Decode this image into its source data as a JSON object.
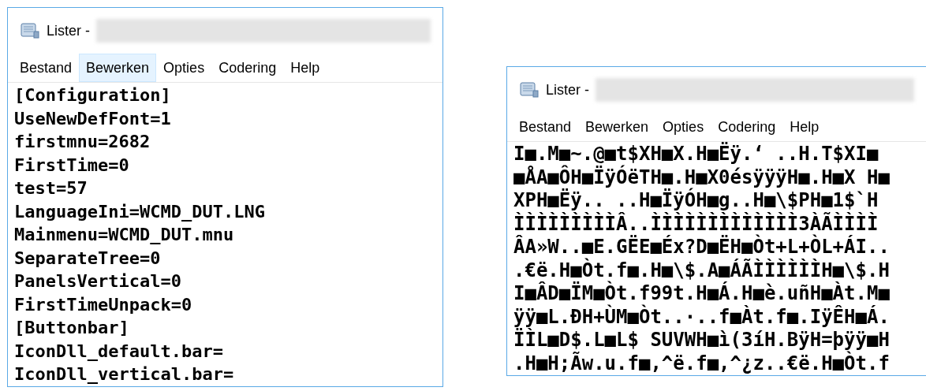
{
  "windows": [
    {
      "title": "Lister -",
      "menu": [
        {
          "label": "Bestand",
          "selected": false
        },
        {
          "label": "Bewerken",
          "selected": true
        },
        {
          "label": "Opties",
          "selected": false
        },
        {
          "label": "Codering",
          "selected": false
        },
        {
          "label": "Help",
          "selected": false
        }
      ],
      "lines": [
        "[Configuration]",
        "UseNewDefFont=1",
        "firstmnu=2682",
        "FirstTime=0",
        "test=57",
        "LanguageIni=WCMD_DUT.LNG",
        "Mainmenu=WCMD_DUT.mnu",
        "SeparateTree=0",
        "PanelsVertical=0",
        "FirstTimeUnpack=0",
        "[Buttonbar]",
        "IconDll_default.bar=",
        "IconDll_vertical.bar="
      ]
    },
    {
      "title": "Lister -",
      "menu": [
        {
          "label": "Bestand",
          "selected": false
        },
        {
          "label": "Bewerken",
          "selected": false
        },
        {
          "label": "Opties",
          "selected": false
        },
        {
          "label": "Codering",
          "selected": false
        },
        {
          "label": "Help",
          "selected": false
        }
      ],
      "lines": [
        "I■.M■~.@■t$XH■X.H■Ëÿ.‘ ..H.T$XI■",
        "■ÅA■ÔH■ÏÿÓëTH■.H■X0ésÿÿÿH■.H■X H■",
        "XPH■Ëÿ.. ..H■ÏÿÓH■g..H■\\$PH■1$`H",
        "ÌÌÌÌÌÌÌÌÌÂ..ÌÌÌÌÌÌÌÌÌÌÌÌÌ3ÀÃÌÌÌÌ",
        "ÂA»W..■E.GËE■Éx?D■ËH■Òt+L+ÒL+ÁI..",
        ".€ë.H■Òt.f■.H■\\$.A■ÁÃÌÌÌÌÌÌH■\\$.H",
        "I■ÂD■ÏM■Òt.f99t.H■Á.H■è.uñH■Àt.M■",
        "ÿÿ■L.ÐH+ÙM■Òt..·..f■Àt.f■.IÿÊH■Á.",
        "ÏÌL■D$.L■L$ SUVWH■ì(3íH.BÿH=þÿÿ■H",
        ".H■H;Ãw.u.f■,^ë.f■,^¿z..€ë.H■Òt.f"
      ]
    }
  ]
}
